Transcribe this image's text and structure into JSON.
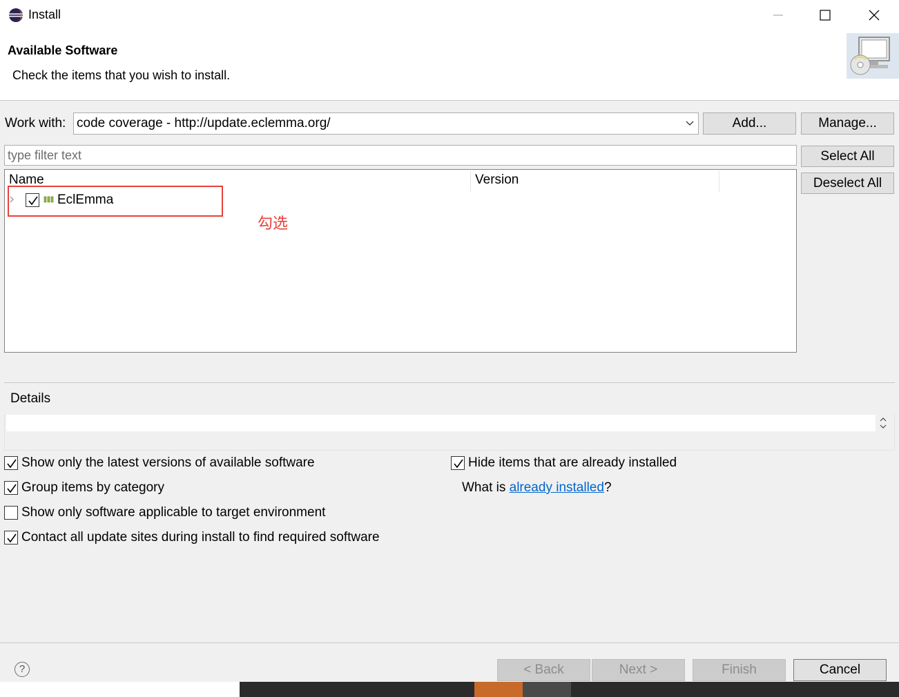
{
  "window": {
    "title": "Install"
  },
  "banner": {
    "title": "Available Software",
    "message": "Check the items that you wish to install."
  },
  "work_with": {
    "label": "Work with:",
    "value": "code coverage - http://update.eclemma.org/",
    "add_label": "Add...",
    "manage_label": "Manage..."
  },
  "filter": {
    "placeholder": "type filter text"
  },
  "side_buttons": {
    "select_all": "Select All",
    "deselect_all": "Deselect All"
  },
  "tree": {
    "columns": [
      "Name",
      "Version"
    ],
    "items": [
      {
        "label": "EclEmma",
        "checked": true,
        "version": ""
      }
    ]
  },
  "annotation": {
    "text": "勾选",
    "color": "#e8403a"
  },
  "details": {
    "label": "Details"
  },
  "options": {
    "latest_versions": "Show only the latest versions of available software",
    "group_by_category": "Group items by category",
    "target_env": "Show only software applicable to target environment",
    "contact_sites": "Contact all update sites during install to find required software",
    "hide_installed": "Hide items that are already installed",
    "what_is_prefix": "What is ",
    "what_is_link": "already installed",
    "what_is_suffix": "?"
  },
  "footer": {
    "back": "< Back",
    "next": "Next >",
    "finish": "Finish",
    "cancel": "Cancel"
  },
  "colors": {
    "link": "#0066cc",
    "highlight": "#e8403a",
    "background": "#f0f0f0"
  }
}
